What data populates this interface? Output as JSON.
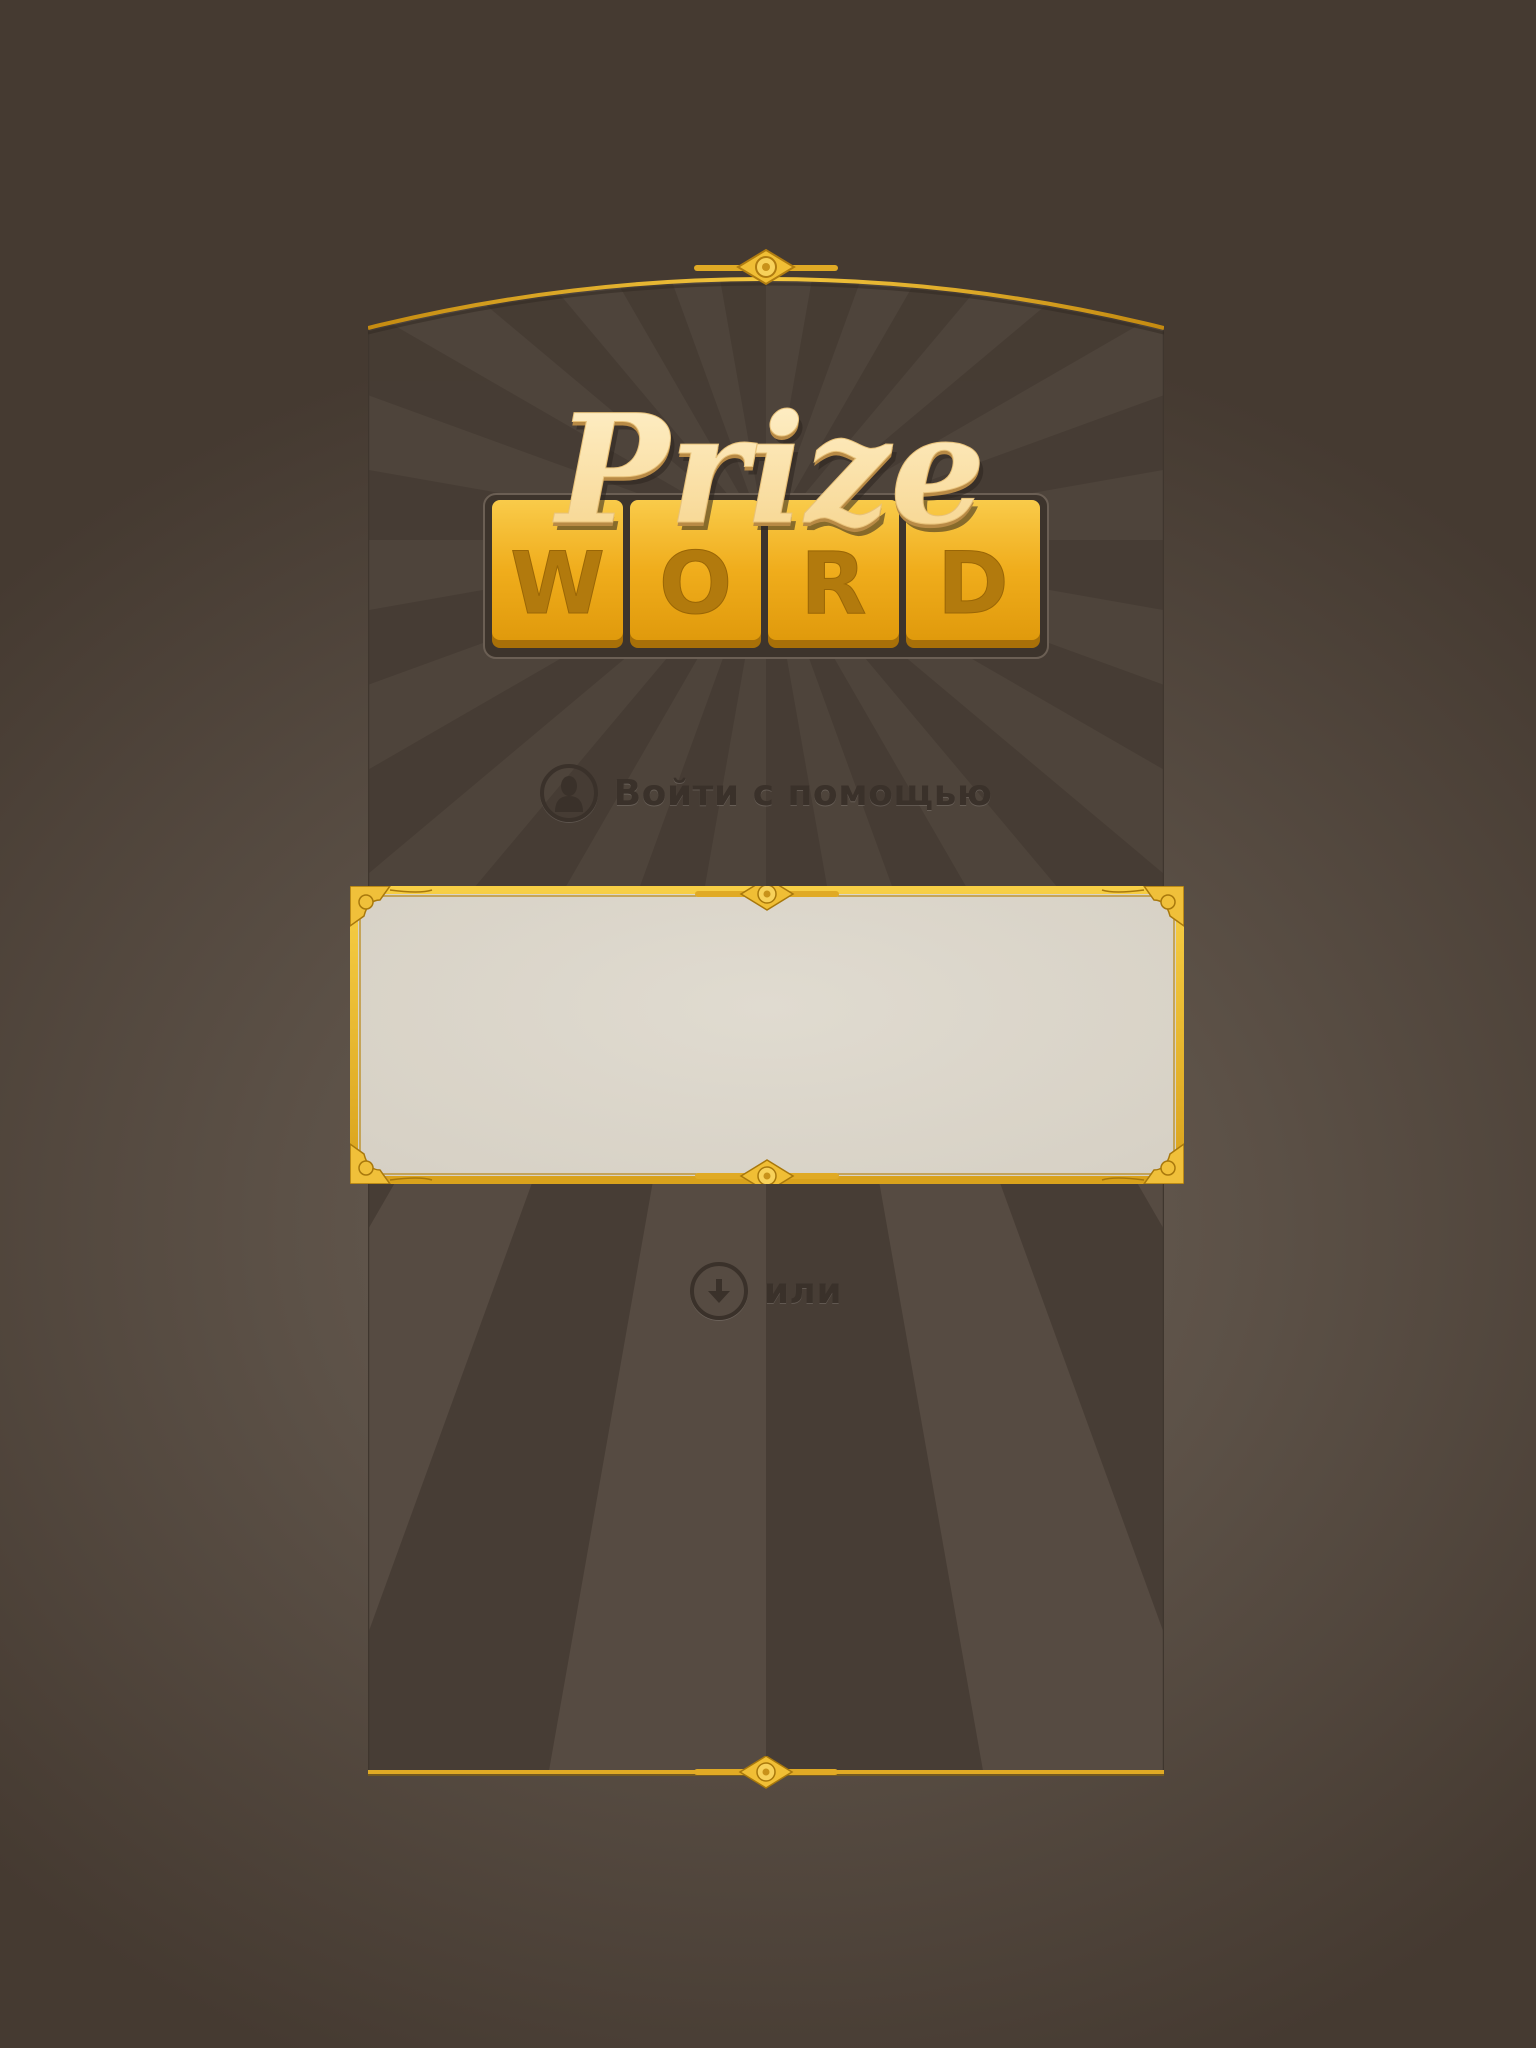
{
  "logo": {
    "script_word": "Prize",
    "tiles": [
      "W",
      "O",
      "R",
      "D"
    ]
  },
  "login": {
    "label": "Войти с помощью",
    "icon": "user-silhouette-icon"
  },
  "login_box": {
    "icon": "ornate-gold-frame"
  },
  "or_row": {
    "label": "или",
    "icon": "arrow-down-icon"
  },
  "colors": {
    "background": "#5c5147",
    "panel": "#564b42",
    "gold": "#e8b22a",
    "tile_gold": "#f0ac1a",
    "paper": "#dcd6ca",
    "text_dark": "#3a312a",
    "logo_cream": "#fbe2a8"
  }
}
